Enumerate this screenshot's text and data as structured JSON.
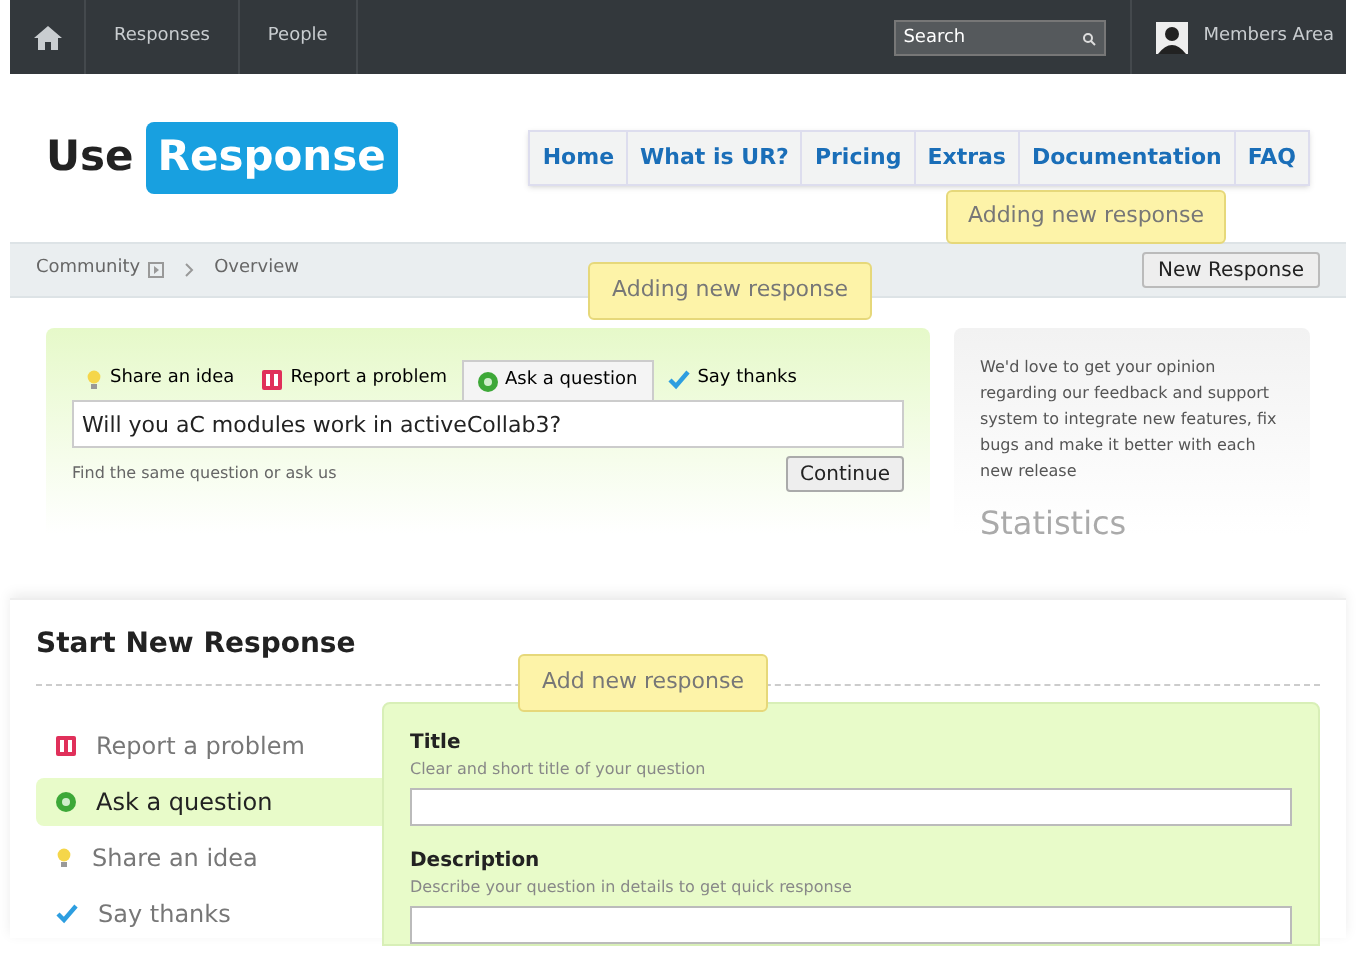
{
  "topbar": {
    "items": [
      {
        "label": "Responses"
      },
      {
        "label": "People"
      }
    ],
    "search": {
      "placeholder": "Search"
    },
    "account": "Members Area"
  },
  "header": {
    "logo": {
      "left": "Use",
      "right": "Response"
    },
    "nav": [
      {
        "label": "Home"
      },
      {
        "label": "What is UR?"
      },
      {
        "label": "Pricing"
      },
      {
        "label": "Extras"
      },
      {
        "label": "Documentation"
      },
      {
        "label": "FAQ"
      }
    ],
    "tooltip": "Adding new response"
  },
  "breadcrumb": {
    "items": [
      "Community",
      "Overview"
    ],
    "button": "New Response",
    "tooltip": "Adding new response"
  },
  "ask_panel": {
    "tabs": [
      {
        "kind": "idea",
        "label": "Share an idea",
        "selected": false
      },
      {
        "kind": "problem",
        "label": "Report a problem",
        "selected": false
      },
      {
        "kind": "question",
        "label": "Ask a question",
        "selected": true
      },
      {
        "kind": "thanks",
        "label": "Say thanks",
        "selected": false
      }
    ],
    "value": "Will you aC modules work in activeCollab3?",
    "hint": "Find the same question or ask us",
    "button": "Continue"
  },
  "side_panel": {
    "text": "We'd love to get your opinion regarding our feedback and support system to integrate new features, fix bugs and make it better with each new release",
    "heading": "Statistics"
  },
  "start_form": {
    "title": "Start New Response",
    "tooltip": "Add new response",
    "categories": [
      {
        "kind": "problem",
        "label": "Report a problem",
        "selected": false
      },
      {
        "kind": "question",
        "label": "Ask a question",
        "selected": true
      },
      {
        "kind": "idea",
        "label": "Share an idea",
        "selected": false
      },
      {
        "kind": "thanks",
        "label": "Say thanks",
        "selected": false
      }
    ],
    "fields": [
      {
        "label": "Title",
        "hint": "Clear and short title of your question"
      },
      {
        "label": "Description",
        "hint": "Describe your question in details to get quick response"
      }
    ]
  }
}
